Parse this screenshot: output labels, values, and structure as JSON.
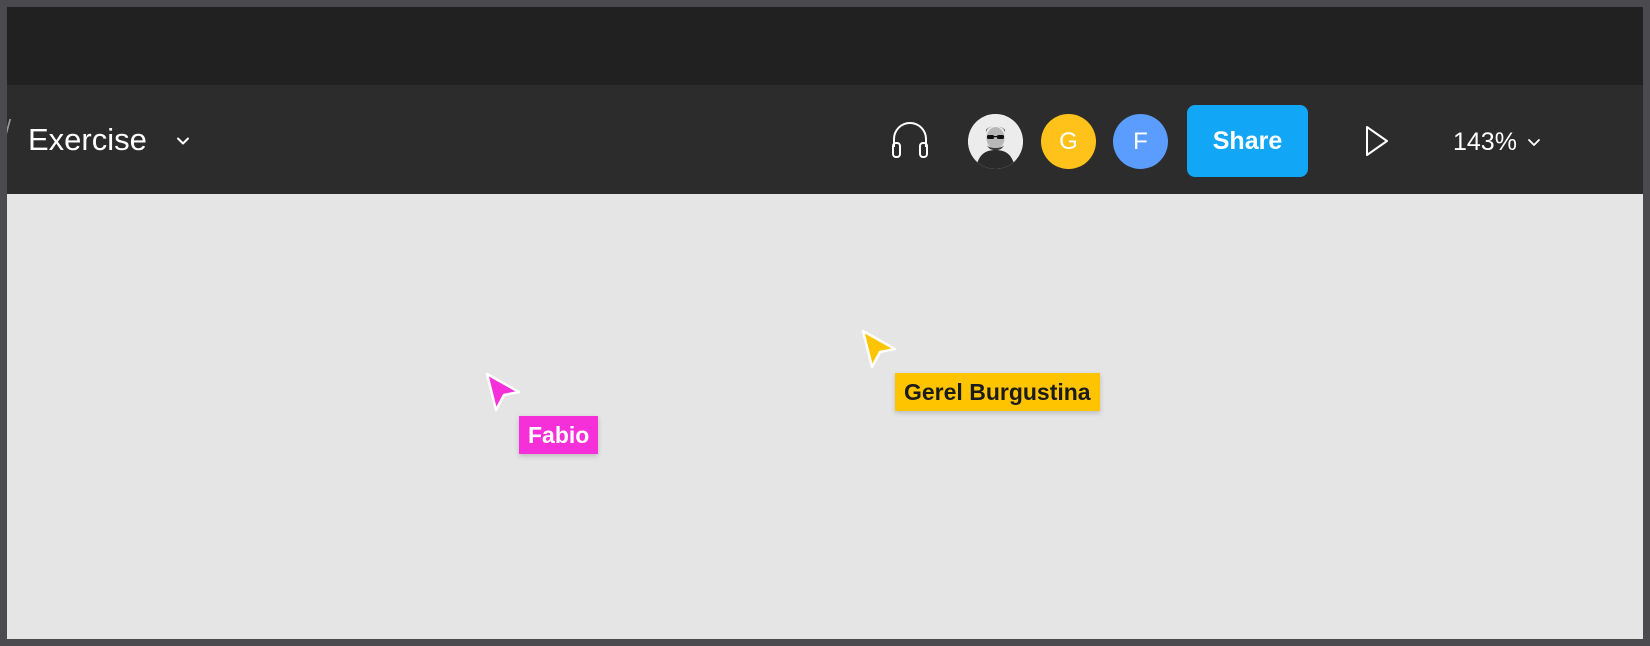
{
  "header": {
    "file_name": "Exercise",
    "zoom": "143%",
    "share_label": "Share"
  },
  "collaborators": [
    {
      "initial": "",
      "type": "photo"
    },
    {
      "initial": "G",
      "color": "#ffc21a"
    },
    {
      "initial": "F",
      "color": "#5b9cff"
    }
  ],
  "cursors": [
    {
      "name": "Fabio",
      "color": "#f530d9"
    },
    {
      "name": "Gerel Burgustina",
      "color": "#ffc400"
    }
  ],
  "icons": {
    "file_menu": "chevron-down-icon",
    "audio": "headphones-icon",
    "present": "play-icon",
    "zoom_menu": "chevron-down-icon"
  },
  "colors": {
    "share_button": "#12a6f7",
    "toolbar": "#2c2c2c",
    "titlebar": "#212121",
    "canvas": "#e5e5e5"
  }
}
